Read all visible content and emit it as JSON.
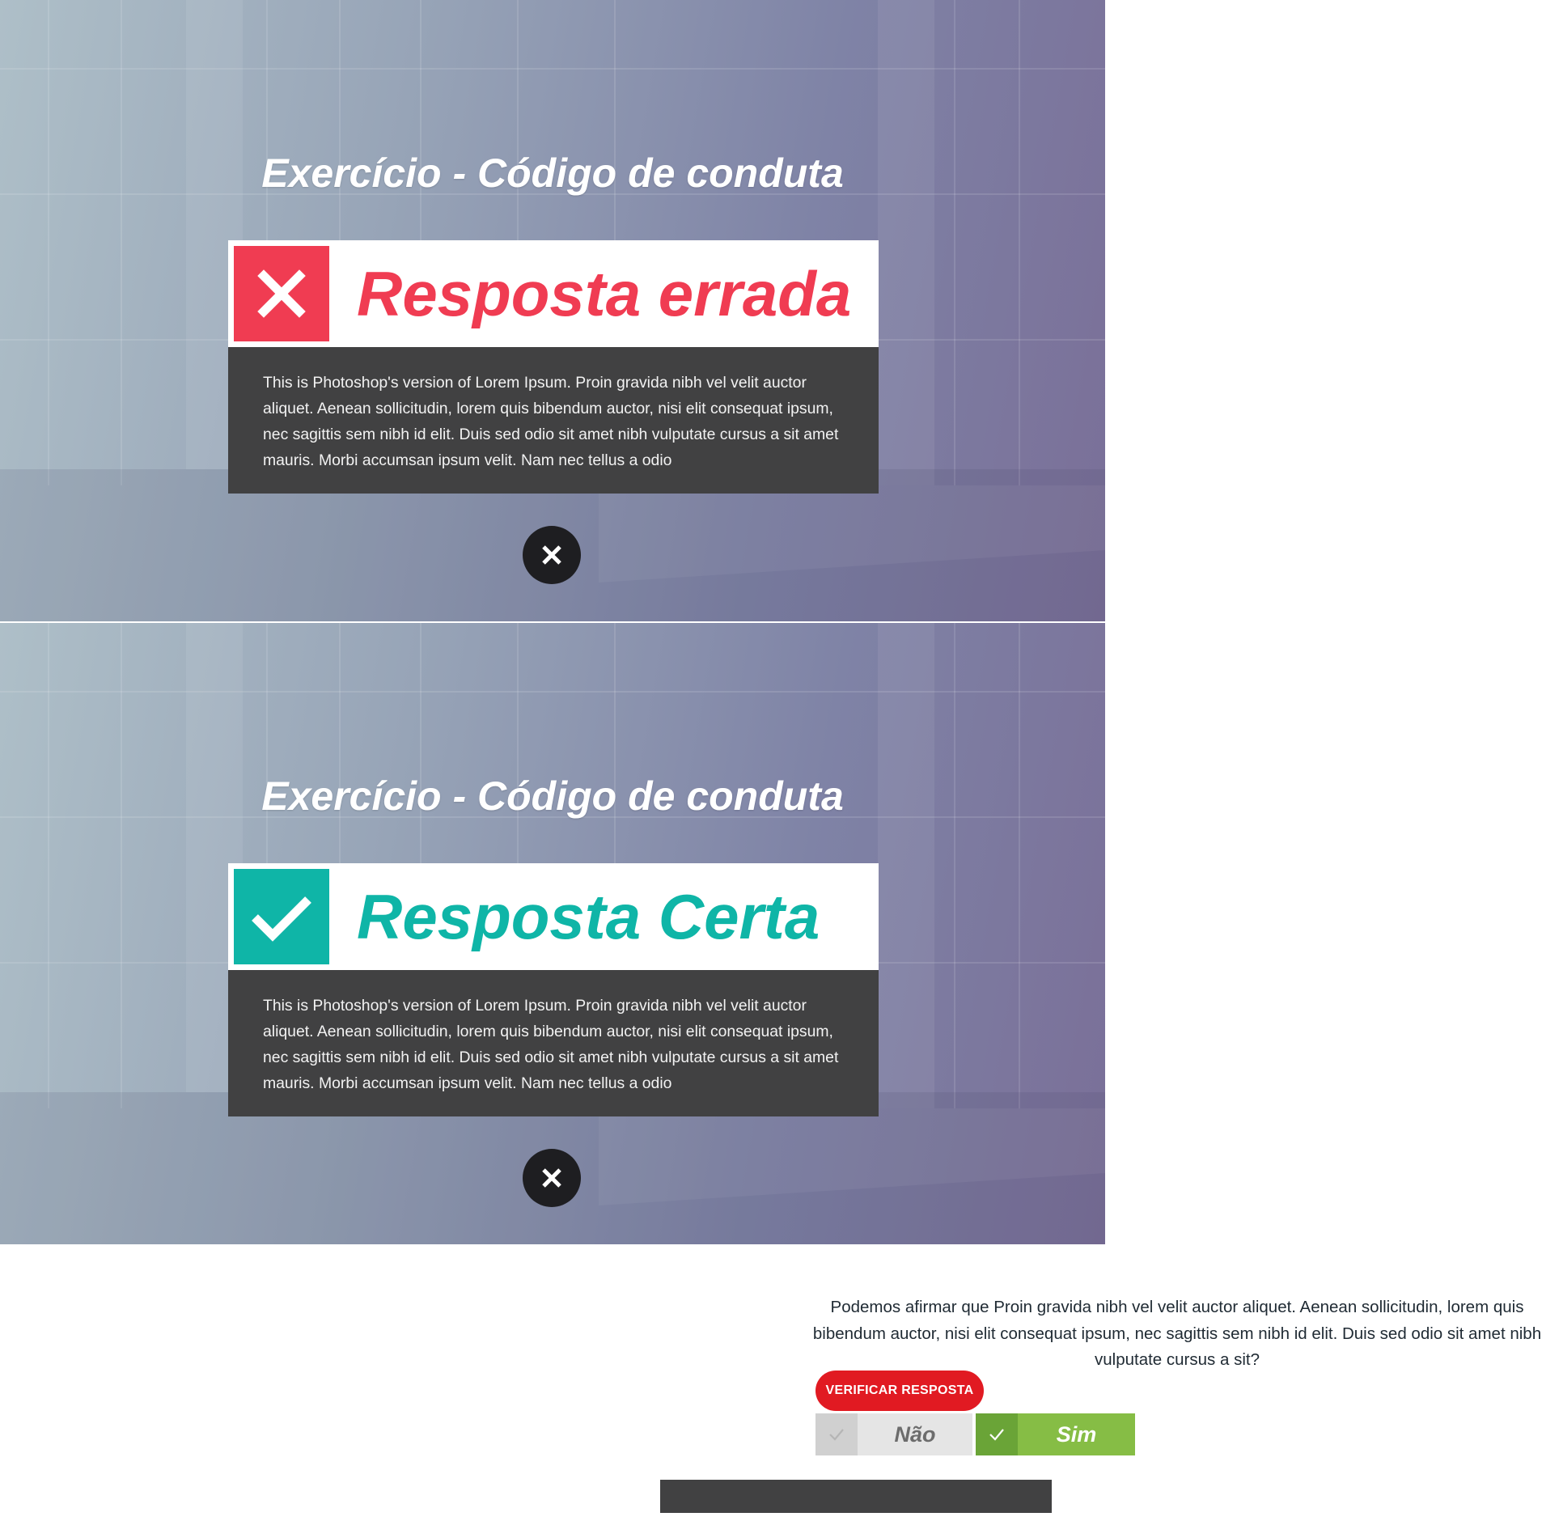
{
  "panels": [
    {
      "title": "Exercício - Código de conduta",
      "result_label": "Resposta errada",
      "result_color": "#f03c52",
      "icon": "close-icon",
      "body": "This is Photoshop's version  of Lorem Ipsum. Proin gravida nibh vel velit auctor aliquet. Aenean sollicitudin, lorem quis bibendum auctor, nisi elit consequat ipsum, nec sagittis sem nibh id elit. Duis sed odio sit amet nibh vulputate cursus a sit amet mauris. Morbi accumsan ipsum velit. Nam nec tellus a odio",
      "close_icon": "close-icon"
    },
    {
      "title": "Exercício - Código de conduta",
      "result_label": "Resposta Certa",
      "result_color": "#0fb5a7",
      "icon": "checkmark-icon",
      "body": "This is Photoshop's version  of Lorem Ipsum. Proin gravida nibh vel velit auctor aliquet. Aenean sollicitudin, lorem quis bibendum auctor, nisi elit consequat ipsum, nec sagittis sem nibh id elit. Duis sed odio sit amet nibh vulputate cursus a sit amet mauris. Morbi accumsan ipsum velit. Nam nec tellus a odio",
      "close_icon": "close-icon"
    }
  ],
  "quiz": {
    "question": "Podemos afirmar que Proin gravida nibh vel velit auctor aliquet. Aenean sollicitudin, lorem quis bibendum auctor, nisi elit consequat ipsum, nec sagittis sem nibh id elit. Duis sed odio sit amet nibh vulputate cursus a sit?",
    "verify_button": "VERIFICAR RESPOSTA",
    "options": [
      {
        "label": "Não",
        "selected": false,
        "color": "#e5e5e5"
      },
      {
        "label": "Sim",
        "selected": true,
        "color": "#86bd45"
      }
    ]
  },
  "colors": {
    "verify_button": "#e11a22",
    "body_box": "#414142",
    "close_button": "#1e1e21"
  }
}
